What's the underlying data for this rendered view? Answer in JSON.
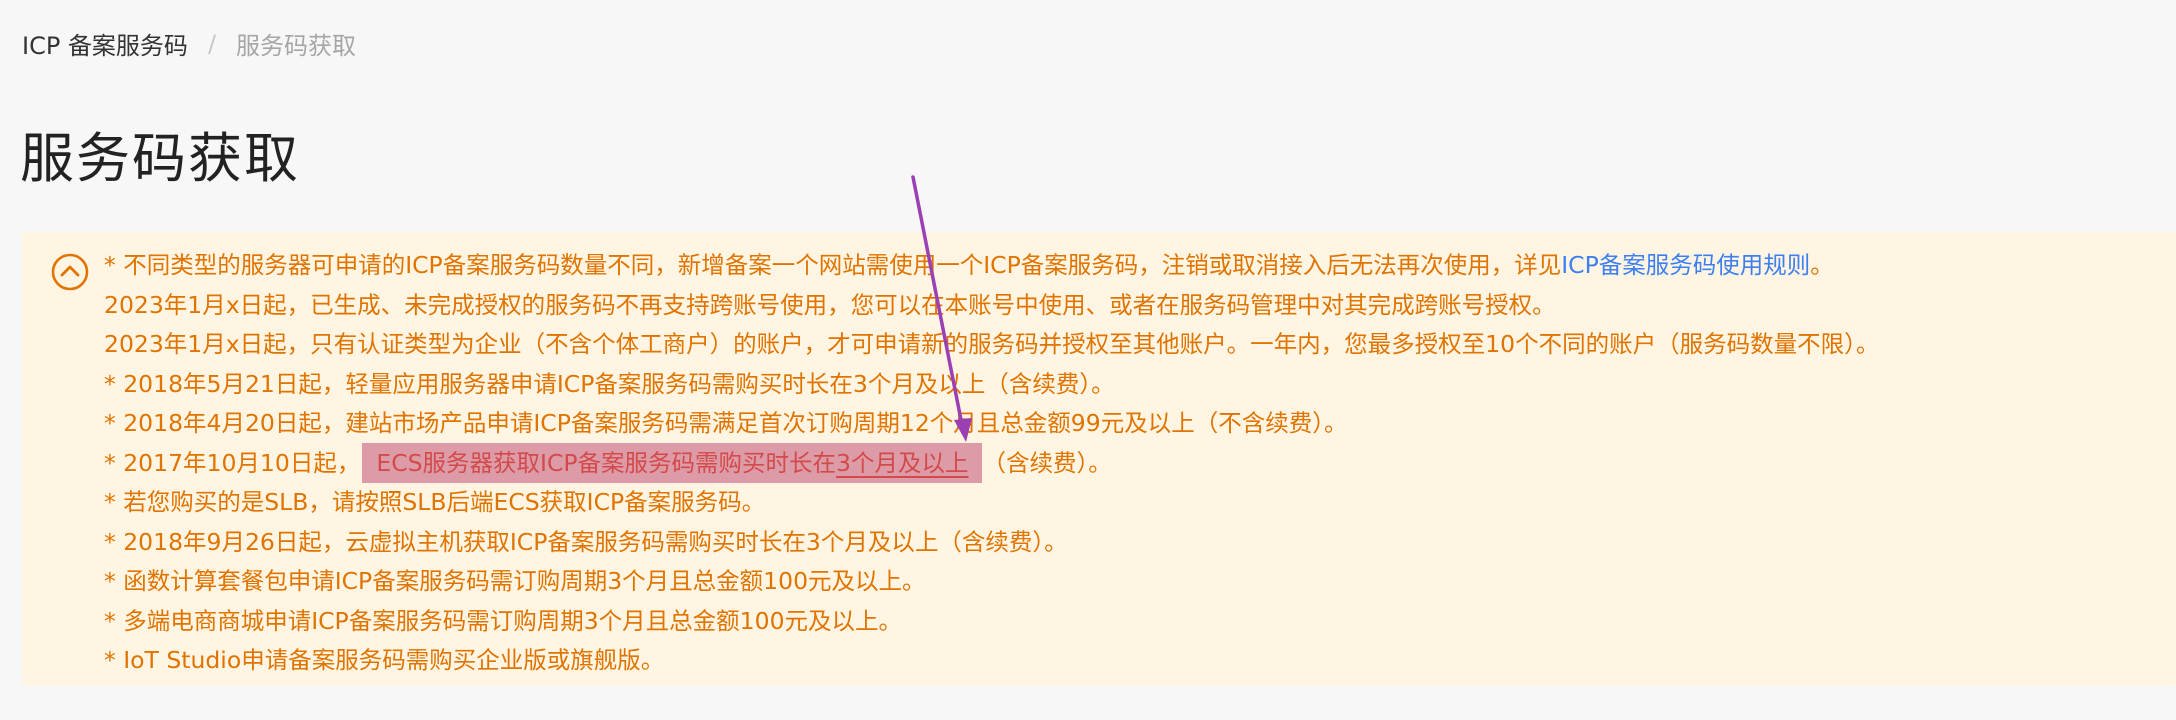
{
  "breadcrumb": {
    "root": "ICP 备案服务码",
    "separator": "/",
    "current": "服务码获取"
  },
  "page": {
    "title": "服务码获取"
  },
  "notice": {
    "line1_prefix": "* 不同类型的服务器可申请的ICP备案服务码数量不同，新增备案一个网站需使用一个ICP备案服务码，注销或取消接入后无法再次使用，详见",
    "line1_link": "ICP备案服务码使用规则",
    "line1_suffix": "。",
    "line2": "2023年1月x日起，已生成、未完成授权的服务码不再支持跨账号使用，您可以在本账号中使用、或者在服务码管理中对其完成跨账号授权。",
    "line3": "2023年1月x日起，只有认证类型为企业（不含个体工商户）的账户，才可申请新的服务码并授权至其他账户。一年内，您最多授权至10个不同的账户（服务码数量不限）。",
    "line4": "* 2018年5月21日起，轻量应用服务器申请ICP备案服务码需购买时长在3个月及以上（含续费）。",
    "line5": "* 2018年4月20日起，建站市场产品申请ICP备案服务码需满足首次订购周期12个月且总金额99元及以上（不含续费）。",
    "line6_prefix": "* 2017年10月10日起，",
    "line6_highlight": "ECS服务器获取ICP备案服务码需购买时长在",
    "line6_underlined": "3个月及以上",
    "line6_suffix": "（含续费）。",
    "line7": "* 若您购买的是SLB，请按照SLB后端ECS获取ICP备案服务码。",
    "line8": "* 2018年9月26日起，云虚拟主机获取ICP备案服务码需购买时长在3个月及以上（含续费）。",
    "line9": "* 函数计算套餐包申请ICP备案服务码需订购周期3个月且总金额100元及以上。",
    "line10": "* 多端电商商城申请ICP备案服务码需订购周期3个月且总金额100元及以上。",
    "line11": "* IoT Studio申请备案服务码需购买企业版或旗舰版。"
  },
  "icons": {
    "collapse": "chevron-up-circle-icon",
    "annotation": "annotation-arrow"
  },
  "colors": {
    "background": "#f7f7f7",
    "notice_bg": "#fff5e2",
    "notice_text": "#e07400",
    "link": "#3b7ff2",
    "highlight": "#d2829a",
    "arrow": "#9b3fb5"
  }
}
